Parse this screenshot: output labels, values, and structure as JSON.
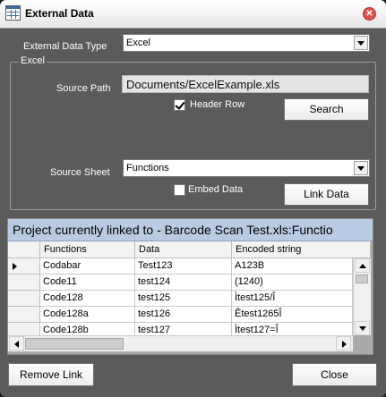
{
  "window": {
    "title": "External Data",
    "close_glyph": "✕"
  },
  "external_data_type": {
    "label": "External Data Type",
    "value": "Excel"
  },
  "excel_group": {
    "title": "Excel",
    "source_path": {
      "label": "Source Path",
      "value": "Documents/ExcelExample.xls"
    },
    "header_row": {
      "label": "Header Row",
      "checked": true
    },
    "search_button": "Search",
    "source_sheet": {
      "label": "Source Sheet",
      "value": "Functions"
    },
    "embed_data": {
      "label": "Embed Data",
      "checked": false
    },
    "link_data_button": "Link Data"
  },
  "grid": {
    "caption": "Project currently linked to - Barcode Scan Test.xls:Functio",
    "columns": [
      "Functions",
      "Data",
      "Encoded string"
    ],
    "rows": [
      {
        "functions": "Codabar",
        "data": "Test123",
        "encoded": "A123B"
      },
      {
        "functions": "Code11",
        "data": "test124",
        "encoded": "(1240)"
      },
      {
        "functions": "Code128",
        "data": "test125",
        "encoded": "Ìtest125/Î"
      },
      {
        "functions": "Code128a",
        "data": "test126",
        "encoded": "Êtest1265Î"
      },
      {
        "functions": "Code128b",
        "data": "test127",
        "encoded": "Ìtest127=Î"
      }
    ]
  },
  "footer": {
    "remove_link_button": "Remove Link",
    "close_button": "Close"
  }
}
